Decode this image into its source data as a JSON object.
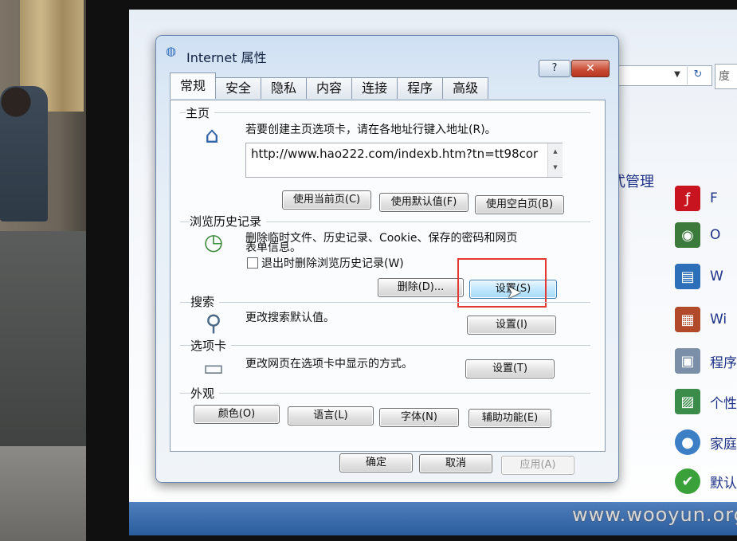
{
  "dialog": {
    "title": "Internet 属性",
    "help": "?",
    "close": "✕",
    "tabs": [
      "常规",
      "安全",
      "隐私",
      "内容",
      "连接",
      "程序",
      "高级"
    ],
    "homepage": {
      "label": "主页",
      "desc": "若要创建主页选项卡，请在各地址行键入地址(R)。",
      "url": "http://www.hao222.com/indexb.htm?tn=tt98cor",
      "use_current": "使用当前页(C)",
      "use_default": "使用默认值(F)",
      "use_blank": "使用空白页(B)"
    },
    "history": {
      "label": "浏览历史记录",
      "desc_line1": "删除临时文件、历史记录、Cookie、保存的密码和网页",
      "desc_line2": "表单信息。",
      "checkbox": "退出时删除浏览历史记录(W)",
      "checked": false,
      "delete": "删除(D)...",
      "settings": "设置(S)"
    },
    "search": {
      "label": "搜索",
      "desc": "更改搜索默认值。",
      "settings": "设置(I)"
    },
    "tabs_section": {
      "label": "选项卡",
      "desc": "更改网页在选项卡中显示的方式。",
      "settings": "设置(T)"
    },
    "appearance": {
      "label": "外观",
      "colors": "颜色(O)",
      "languages": "语言(L)",
      "fonts": "字体(N)",
      "accessibility": "辅助功能(E)"
    },
    "footer": {
      "ok": "确定",
      "cancel": "取消",
      "apply": "应用(A)"
    }
  },
  "control_panel": {
    "heading_fragment": "式管理",
    "items": [
      {
        "label": "F",
        "icon": "flash-icon",
        "color": "#c8141e"
      },
      {
        "label": "O",
        "icon": "cd-icon",
        "color": "#3b7a3a"
      },
      {
        "label": "W",
        "icon": "windows-icon",
        "color": "#2d6fb8"
      },
      {
        "label": "Wi",
        "icon": "firewall-icon",
        "color": "#b04a2a"
      },
      {
        "label": "程序",
        "icon": "programs-icon",
        "color": "#7b8fa8"
      },
      {
        "label": "个性",
        "icon": "personalization-icon",
        "color": "#3b8c4a"
      },
      {
        "label": "家庭",
        "icon": "homegroup-icon",
        "color": "#3d7fc4"
      },
      {
        "label": "默认程",
        "icon": "default-programs-icon",
        "color": "#3aa03a"
      }
    ]
  },
  "watermark": "www.wooyun.org",
  "highlight_color": "#e23a33"
}
